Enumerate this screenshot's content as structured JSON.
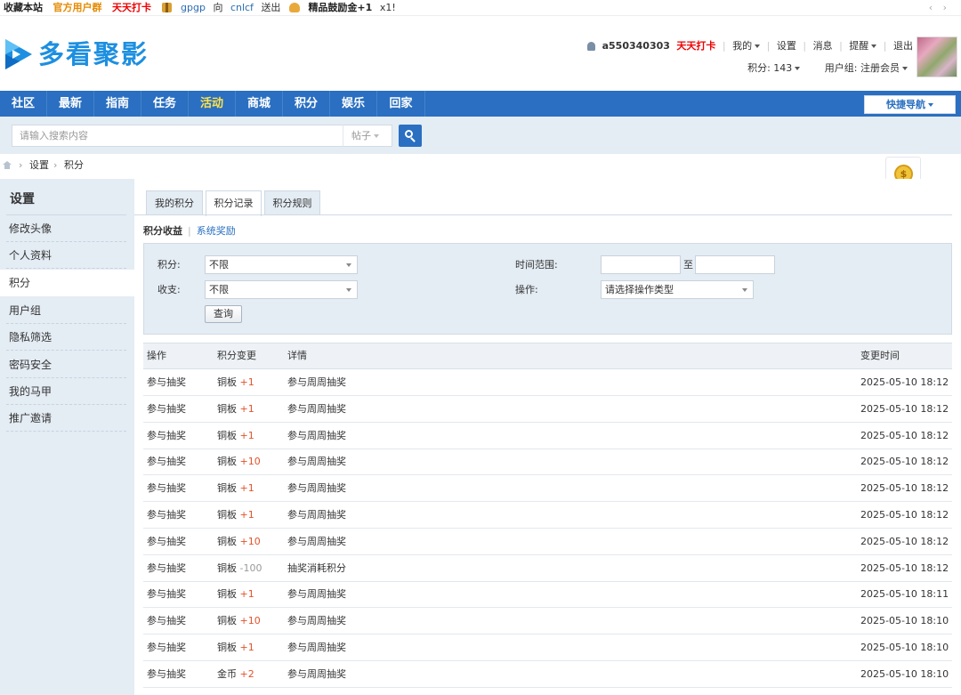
{
  "topbar": {
    "favorite": "收藏本站",
    "user_group": "官方用户群",
    "checkin": "天天打卡",
    "gift_from": "gpgp",
    "gift_to_word": "向",
    "gift_to": "cnlcf",
    "gift_sent": "送出",
    "reward": "精品鼓励金+1",
    "reward_count": "x1!",
    "nav_arrows": "‹ ›"
  },
  "header": {
    "logo_text": "多看聚影",
    "username": "a550340303",
    "checkin": "天天打卡",
    "links": [
      "我的",
      "设置",
      "消息",
      "提醒",
      "退出"
    ],
    "points": "积分: 143",
    "group": "用户组: 注册会员"
  },
  "nav": {
    "items": [
      "社区",
      "最新",
      "指南",
      "任务",
      "活动",
      "商城",
      "积分",
      "娱乐",
      "回家"
    ],
    "active": "活动",
    "quick": "快捷导航"
  },
  "search": {
    "placeholder": "请输入搜索内容",
    "type": "帖子"
  },
  "breadcrumb": {
    "items": [
      "设置",
      "积分"
    ]
  },
  "sidebar": {
    "title": "设置",
    "items": [
      "修改头像",
      "个人资料",
      "积分",
      "用户组",
      "隐私筛选",
      "密码安全",
      "我的马甲",
      "推广邀请"
    ],
    "active": "积分"
  },
  "main": {
    "tabs": [
      "我的积分",
      "积分记录",
      "积分规则"
    ],
    "active_tab": "积分记录",
    "subtabs": [
      "积分收益",
      "系统奖励"
    ],
    "filter": {
      "points_label": "积分:",
      "points_value": "不限",
      "inout_label": "收支:",
      "inout_value": "不限",
      "time_label": "时间范围:",
      "time_to": "至",
      "op_label": "操作:",
      "op_value": "请选择操作类型",
      "query": "查询"
    },
    "table": {
      "headers": [
        "操作",
        "积分变更",
        "详情",
        "变更时间"
      ],
      "rows": [
        {
          "op": "参与抽奖",
          "type": "铜板",
          "delta": "+1",
          "detail": "参与周周抽奖",
          "time": "2025-05-10 18:12"
        },
        {
          "op": "参与抽奖",
          "type": "铜板",
          "delta": "+1",
          "detail": "参与周周抽奖",
          "time": "2025-05-10 18:12"
        },
        {
          "op": "参与抽奖",
          "type": "铜板",
          "delta": "+1",
          "detail": "参与周周抽奖",
          "time": "2025-05-10 18:12"
        },
        {
          "op": "参与抽奖",
          "type": "铜板",
          "delta": "+10",
          "detail": "参与周周抽奖",
          "time": "2025-05-10 18:12"
        },
        {
          "op": "参与抽奖",
          "type": "铜板",
          "delta": "+1",
          "detail": "参与周周抽奖",
          "time": "2025-05-10 18:12"
        },
        {
          "op": "参与抽奖",
          "type": "铜板",
          "delta": "+1",
          "detail": "参与周周抽奖",
          "time": "2025-05-10 18:12"
        },
        {
          "op": "参与抽奖",
          "type": "铜板",
          "delta": "+10",
          "detail": "参与周周抽奖",
          "time": "2025-05-10 18:12"
        },
        {
          "op": "参与抽奖",
          "type": "铜板",
          "delta": "-100",
          "detail": "抽奖消耗积分",
          "time": "2025-05-10 18:12"
        },
        {
          "op": "参与抽奖",
          "type": "铜板",
          "delta": "+1",
          "detail": "参与周周抽奖",
          "time": "2025-05-10 18:11"
        },
        {
          "op": "参与抽奖",
          "type": "铜板",
          "delta": "+10",
          "detail": "参与周周抽奖",
          "time": "2025-05-10 18:10"
        },
        {
          "op": "参与抽奖",
          "type": "铜板",
          "delta": "+1",
          "detail": "参与周周抽奖",
          "time": "2025-05-10 18:10"
        },
        {
          "op": "参与抽奖",
          "type": "金币",
          "delta": "+2",
          "detail": "参与周周抽奖",
          "time": "2025-05-10 18:10"
        }
      ]
    }
  },
  "colors": {
    "nav_bg": "#2a6fc1",
    "nav_active": "#ffe24a",
    "panel_bg": "#e4ecf4",
    "delta_plus": "#e0532b",
    "checkin_red": "#ee0000"
  }
}
